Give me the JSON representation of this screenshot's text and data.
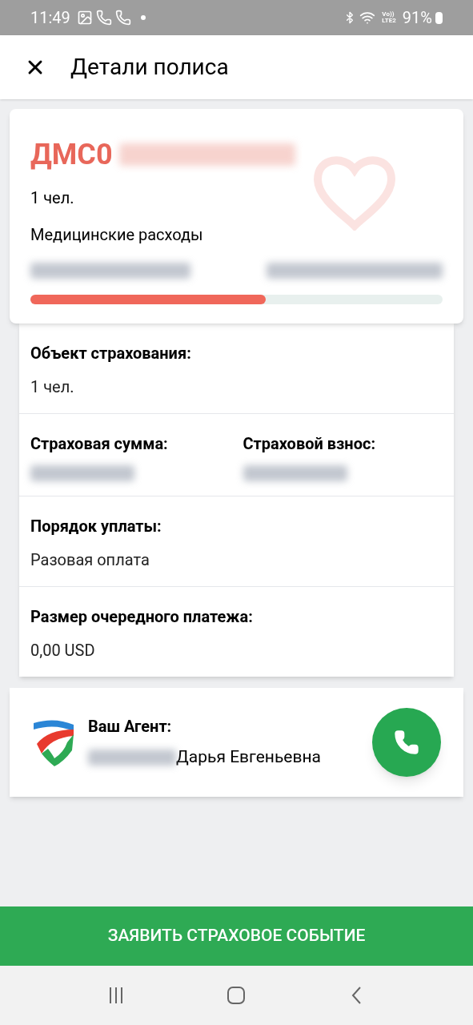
{
  "status_bar": {
    "time": "11:49",
    "volte": "Vo))",
    "lte": "LTE2",
    "battery": "91%"
  },
  "header": {
    "title": "Детали полиса"
  },
  "policy_card": {
    "title": "ДМС0",
    "title_hidden_part": true,
    "persons": "1 чел.",
    "program": "Медицинские расходы",
    "dates_hidden": true,
    "level": 0.57
  },
  "details": [
    {
      "kind": "single",
      "fields": [
        {
          "label": "Объект страхования:",
          "value": "1 чел.",
          "value_hidden": false
        }
      ]
    },
    {
      "kind": "pair",
      "fields": [
        {
          "label": "Страховая сумма:",
          "value_hidden": true
        },
        {
          "label": "Страховой взнос:",
          "value_hidden": true
        }
      ]
    },
    {
      "kind": "single",
      "fields": [
        {
          "label": "Порядок уплаты:",
          "value": "Разовая оплата",
          "value_hidden": false
        }
      ]
    },
    {
      "kind": "single",
      "fields": [
        {
          "label": "Размер очередного платежа:",
          "value": "0,00 USD",
          "value_hidden": false
        }
      ]
    }
  ],
  "agent": {
    "label": "Ваш Агент:",
    "name": "Дарья Евгеньевна",
    "name_hidden_part": true
  },
  "action_button": "ЗАЯВИТЬ СТРАХОВОЕ СОБЫТИЕ"
}
